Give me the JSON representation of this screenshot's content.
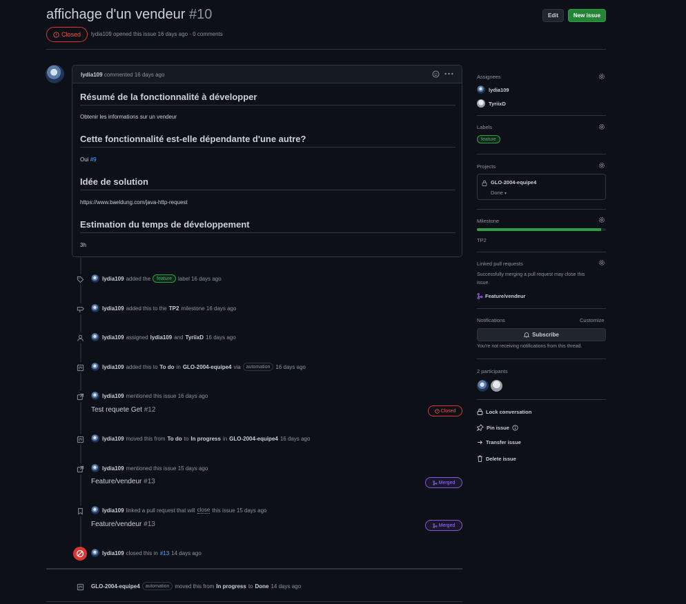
{
  "header": {
    "title": "affichage d'un vendeur",
    "number": "#10",
    "edit_label": "Edit",
    "new_issue_label": "New issue",
    "state": "Closed",
    "meta_author": "lydia109",
    "meta_text": "opened this issue 16 days ago · 0 comments"
  },
  "comment": {
    "author": "lydia109",
    "action": "commented 16 days ago",
    "sections": [
      {
        "heading": "Résumé de la fonctionnalité à développer",
        "body": "Obtenir les informations sur un vendeur"
      },
      {
        "heading": "Cette fonctionnalité est-elle dépendante d'une autre?",
        "body_prefix": "Oui",
        "body_link": "#9"
      },
      {
        "heading": "Idée de solution",
        "body_link": "https://www.baeldung.com/java-http-request"
      },
      {
        "heading": "Estimation du temps de développement",
        "body": "3h"
      }
    ]
  },
  "timeline": {
    "e1": {
      "user": "lydia109",
      "t1": "added the",
      "label": "feature",
      "t2": "label 16 days ago"
    },
    "e2": {
      "user": "lydia109",
      "t1": "added this to the",
      "milestone": "TP2",
      "t2": "milestone 16 days ago"
    },
    "e3": {
      "user": "lydia109",
      "t1": "assigned",
      "a1": "lydia109",
      "and": "and",
      "a2": "TyriixD",
      "t2": "16 days ago"
    },
    "e4": {
      "user": "lydia109",
      "t1": "added this to",
      "col": "To do",
      "in": "in",
      "proj": "GLO-2004-equipe4",
      "via": "via",
      "pill": "automation",
      "t2": "16 days ago"
    },
    "e5": {
      "user": "lydia109",
      "t1": "mentioned this issue 16 days ago",
      "ref": "Test requete Get",
      "ref_num": "#12",
      "status": "Closed"
    },
    "e6": {
      "user": "lydia109",
      "t1": "moved this from",
      "from": "To do",
      "to_word": "to",
      "to": "In progress",
      "in": "in",
      "proj": "GLO-2004-equipe4",
      "t2": "16 days ago"
    },
    "e7": {
      "user": "lydia109",
      "t1": "mentioned this issue 15 days ago",
      "ref": "Feature/vendeur",
      "ref_num": "#13",
      "status": "Merged"
    },
    "e8": {
      "user": "lydia109",
      "t1": "linked a pull request that will",
      "close": "close",
      "t2": "this issue 15 days ago",
      "ref": "Feature/vendeur",
      "ref_num": "#13",
      "status": "Merged"
    },
    "e9": {
      "user": "lydia109",
      "t1": "closed this in",
      "link": "#13",
      "t2": "14 days ago"
    },
    "e10": {
      "proj": "GLO-2004-equipe4",
      "pill": "automation",
      "t1": "moved this from",
      "from": "In progress",
      "to_word": "to",
      "to": "Done",
      "t2": "14 days ago"
    }
  },
  "sidebar": {
    "assignees_title": "Assignees",
    "assignee1": "lydia109",
    "assignee2": "TyriixD",
    "labels_title": "Labels",
    "label1": "feature",
    "projects_title": "Projects",
    "project_name": "GLO-2004-equipe4",
    "project_status": "Done",
    "milestone_title": "Milestone",
    "milestone_progress": 0.96,
    "milestone_name": "TP2",
    "linked_title": "Linked pull requests",
    "linked_desc1": "Successfully merging a pull request may close this",
    "linked_desc2": "issue.",
    "linked_pr": "Feature/vendeur",
    "notifications_title": "Notifications",
    "customize": "Customize",
    "subscribe": "Subscribe",
    "notif_desc": "You're not receiving notifications from this thread.",
    "participants": "2 participants",
    "lock": "Lock conversation",
    "pin": "Pin issue",
    "transfer": "Transfer issue",
    "delete": "Delete issue"
  }
}
